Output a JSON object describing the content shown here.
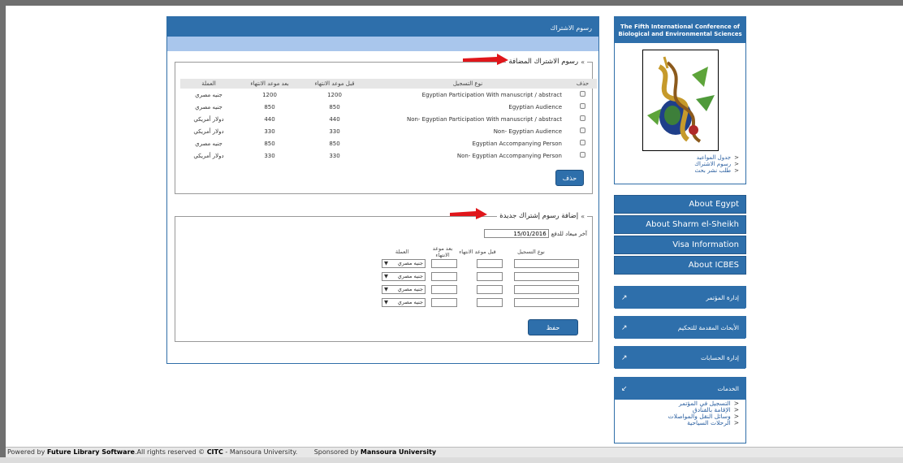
{
  "footer": {
    "powered_prefix": "Powered by ",
    "powered_name": "Future Library Software",
    "rights_text": ".All rights reserved © ",
    "citc": "CITC",
    "university_text": " - Mansoura University.",
    "sponsored_prefix": "Sponsored by ",
    "sponsor": "Mansoura University"
  },
  "main": {
    "title": "رسوم الاشتراك",
    "added_fees": {
      "legend": "رسوم الاشتراك المضافة",
      "headers": {
        "delete": "حذف",
        "type": "نوع التسجيل",
        "before": "قبل موعد الانتهاء",
        "after": "بعد موعد الانتهاء",
        "currency": "العملة"
      },
      "rows": [
        {
          "type": "Egyptian Participation With manuscript / abstract",
          "before": "1200",
          "after": "1200",
          "currency": "جنيه مصري"
        },
        {
          "type": "Egyptian Audience",
          "before": "850",
          "after": "850",
          "currency": "جنيه مصري"
        },
        {
          "type": "Non- Egyptian Participation With manuscript / abstract",
          "before": "440",
          "after": "440",
          "currency": "دولار أمريكي"
        },
        {
          "type": "Non- Egyptian Audience",
          "before": "330",
          "after": "330",
          "currency": "دولار أمريكي"
        },
        {
          "type": "Egyptian Accompanying Person",
          "before": "850",
          "after": "850",
          "currency": "جنيه مصري"
        },
        {
          "type": "Non- Egyptian Accompanying Person",
          "before": "330",
          "after": "330",
          "currency": "دولار أمريكي"
        }
      ],
      "delete_button": "حذف"
    },
    "new_fee": {
      "legend": "إضافة رسوم إشتراك جديدة",
      "deadline_label": "آخر ميعاد للدفع",
      "deadline_value": "15/01/2016",
      "headers": {
        "type": "نوع التسجيل",
        "before": "قبل موعد الانتهاء",
        "after": "بعد موعد الانتهاء",
        "currency": "العملة"
      },
      "currency_default": "جنيه مصري",
      "save_button": "حفظ"
    }
  },
  "sidebar": {
    "conference_title_line1": "The Fifth International Conference of",
    "conference_title_line2": "Biological and Environmental Sciences",
    "links": [
      "جدول المواعيد",
      "رسوم الاشتراك",
      "طلب نشر بحث"
    ],
    "nav": [
      "About Egypt",
      "About Sharm el-Sheikh",
      "Visa Information",
      "About ICBES"
    ],
    "menus": [
      "إدارة المؤتمر",
      "الأبحاث المقدمة للتحكيم",
      "إدارة الحسابات",
      "الخدمات"
    ],
    "services": [
      "التسجيل في المؤتمر",
      "الإقامة بالفنادق",
      "وسائل النقل والمواصلات",
      "الرحلات السياحية"
    ]
  },
  "colors": {
    "header_blue": "#2e6fab",
    "light_blue": "#a9c6ec",
    "arrow_red": "#e0161b"
  }
}
